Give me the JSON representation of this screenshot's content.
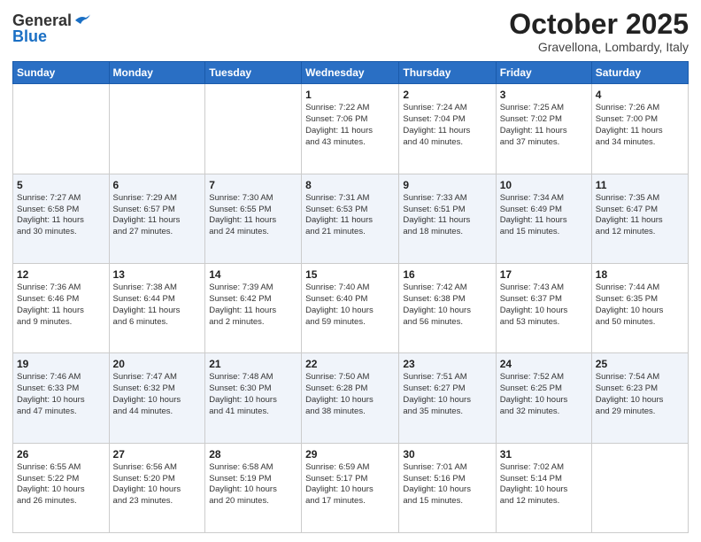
{
  "header": {
    "logo": {
      "line1": "General",
      "line2": "Blue"
    },
    "month": "October 2025",
    "location": "Gravellona, Lombardy, Italy"
  },
  "weekdays": [
    "Sunday",
    "Monday",
    "Tuesday",
    "Wednesday",
    "Thursday",
    "Friday",
    "Saturday"
  ],
  "weeks": [
    [
      {
        "day": "",
        "info": ""
      },
      {
        "day": "",
        "info": ""
      },
      {
        "day": "",
        "info": ""
      },
      {
        "day": "1",
        "info": "Sunrise: 7:22 AM\nSunset: 7:06 PM\nDaylight: 11 hours\nand 43 minutes."
      },
      {
        "day": "2",
        "info": "Sunrise: 7:24 AM\nSunset: 7:04 PM\nDaylight: 11 hours\nand 40 minutes."
      },
      {
        "day": "3",
        "info": "Sunrise: 7:25 AM\nSunset: 7:02 PM\nDaylight: 11 hours\nand 37 minutes."
      },
      {
        "day": "4",
        "info": "Sunrise: 7:26 AM\nSunset: 7:00 PM\nDaylight: 11 hours\nand 34 minutes."
      }
    ],
    [
      {
        "day": "5",
        "info": "Sunrise: 7:27 AM\nSunset: 6:58 PM\nDaylight: 11 hours\nand 30 minutes."
      },
      {
        "day": "6",
        "info": "Sunrise: 7:29 AM\nSunset: 6:57 PM\nDaylight: 11 hours\nand 27 minutes."
      },
      {
        "day": "7",
        "info": "Sunrise: 7:30 AM\nSunset: 6:55 PM\nDaylight: 11 hours\nand 24 minutes."
      },
      {
        "day": "8",
        "info": "Sunrise: 7:31 AM\nSunset: 6:53 PM\nDaylight: 11 hours\nand 21 minutes."
      },
      {
        "day": "9",
        "info": "Sunrise: 7:33 AM\nSunset: 6:51 PM\nDaylight: 11 hours\nand 18 minutes."
      },
      {
        "day": "10",
        "info": "Sunrise: 7:34 AM\nSunset: 6:49 PM\nDaylight: 11 hours\nand 15 minutes."
      },
      {
        "day": "11",
        "info": "Sunrise: 7:35 AM\nSunset: 6:47 PM\nDaylight: 11 hours\nand 12 minutes."
      }
    ],
    [
      {
        "day": "12",
        "info": "Sunrise: 7:36 AM\nSunset: 6:46 PM\nDaylight: 11 hours\nand 9 minutes."
      },
      {
        "day": "13",
        "info": "Sunrise: 7:38 AM\nSunset: 6:44 PM\nDaylight: 11 hours\nand 6 minutes."
      },
      {
        "day": "14",
        "info": "Sunrise: 7:39 AM\nSunset: 6:42 PM\nDaylight: 11 hours\nand 2 minutes."
      },
      {
        "day": "15",
        "info": "Sunrise: 7:40 AM\nSunset: 6:40 PM\nDaylight: 10 hours\nand 59 minutes."
      },
      {
        "day": "16",
        "info": "Sunrise: 7:42 AM\nSunset: 6:38 PM\nDaylight: 10 hours\nand 56 minutes."
      },
      {
        "day": "17",
        "info": "Sunrise: 7:43 AM\nSunset: 6:37 PM\nDaylight: 10 hours\nand 53 minutes."
      },
      {
        "day": "18",
        "info": "Sunrise: 7:44 AM\nSunset: 6:35 PM\nDaylight: 10 hours\nand 50 minutes."
      }
    ],
    [
      {
        "day": "19",
        "info": "Sunrise: 7:46 AM\nSunset: 6:33 PM\nDaylight: 10 hours\nand 47 minutes."
      },
      {
        "day": "20",
        "info": "Sunrise: 7:47 AM\nSunset: 6:32 PM\nDaylight: 10 hours\nand 44 minutes."
      },
      {
        "day": "21",
        "info": "Sunrise: 7:48 AM\nSunset: 6:30 PM\nDaylight: 10 hours\nand 41 minutes."
      },
      {
        "day": "22",
        "info": "Sunrise: 7:50 AM\nSunset: 6:28 PM\nDaylight: 10 hours\nand 38 minutes."
      },
      {
        "day": "23",
        "info": "Sunrise: 7:51 AM\nSunset: 6:27 PM\nDaylight: 10 hours\nand 35 minutes."
      },
      {
        "day": "24",
        "info": "Sunrise: 7:52 AM\nSunset: 6:25 PM\nDaylight: 10 hours\nand 32 minutes."
      },
      {
        "day": "25",
        "info": "Sunrise: 7:54 AM\nSunset: 6:23 PM\nDaylight: 10 hours\nand 29 minutes."
      }
    ],
    [
      {
        "day": "26",
        "info": "Sunrise: 6:55 AM\nSunset: 5:22 PM\nDaylight: 10 hours\nand 26 minutes."
      },
      {
        "day": "27",
        "info": "Sunrise: 6:56 AM\nSunset: 5:20 PM\nDaylight: 10 hours\nand 23 minutes."
      },
      {
        "day": "28",
        "info": "Sunrise: 6:58 AM\nSunset: 5:19 PM\nDaylight: 10 hours\nand 20 minutes."
      },
      {
        "day": "29",
        "info": "Sunrise: 6:59 AM\nSunset: 5:17 PM\nDaylight: 10 hours\nand 17 minutes."
      },
      {
        "day": "30",
        "info": "Sunrise: 7:01 AM\nSunset: 5:16 PM\nDaylight: 10 hours\nand 15 minutes."
      },
      {
        "day": "31",
        "info": "Sunrise: 7:02 AM\nSunset: 5:14 PM\nDaylight: 10 hours\nand 12 minutes."
      },
      {
        "day": "",
        "info": ""
      }
    ]
  ]
}
